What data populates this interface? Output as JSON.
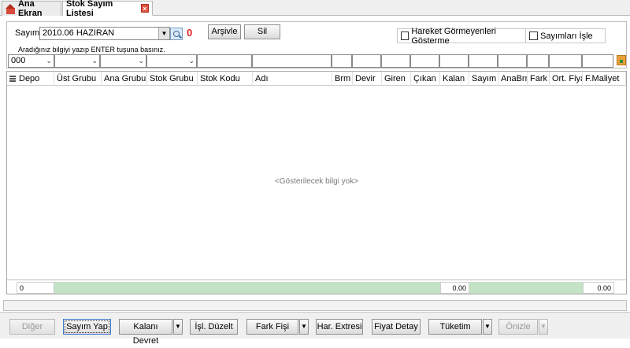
{
  "tabs": [
    {
      "label": "Ana Ekran"
    },
    {
      "label": "Stok Sayım Listesi"
    }
  ],
  "filters": {
    "sayim_label": "Sayım",
    "sayim_value": "2010.06 HAZIRAN",
    "count": "0",
    "arsivle_label": "Arşivle",
    "sil_label": "Sil",
    "hareket_label": "Hareket Görmeyenleri Gösterme",
    "sayimlari_label": "Sayımları İşle",
    "hint": "Aradığınız bilgiyi yazıp ENTER tuşuna basınız.",
    "depo_value": "000"
  },
  "columns": [
    "Depo",
    "Üst Grubu",
    "Ana Grubu",
    "Stok Grubu",
    "Stok Kodu",
    "Adı",
    "Brm",
    "Devir",
    "Giren",
    "Çıkan",
    "Kalan",
    "Sayım",
    "AnaBrm",
    "Fark",
    "Ort. Fiyat",
    "F.Maliyet"
  ],
  "grid": {
    "empty_message": "<Gösterilecek bilgi yok>",
    "footer_count": "0",
    "footer_kalan": "0.00",
    "footer_maliyet": "0.00"
  },
  "toolbar": {
    "diger": "Diğer",
    "sayim_yap": "Sayım Yap",
    "kalani_devret": "Kalanı Devret",
    "isl_duzelt": "İşl. Düzelt",
    "fark_fisi": "Fark Fişi",
    "har_extresi": "Har. Extresi",
    "fiyat_detay": "Fiyat Detay",
    "tuketim": "Tüketim",
    "onizle": "Önizle"
  },
  "colors": {
    "accent_red": "#e0201e",
    "footer_green": "#c4e2c6"
  }
}
